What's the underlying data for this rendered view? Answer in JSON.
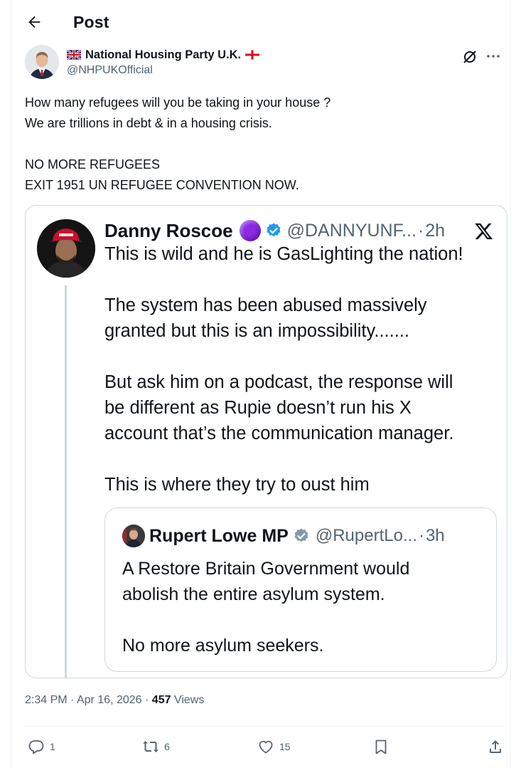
{
  "header": {
    "title": "Post"
  },
  "author": {
    "name": "National Housing Party U.K.",
    "handle": "@NHPUKOfficial"
  },
  "post": {
    "lines": [
      "How many refugees will you be taking in your house ?",
      "We are trillions in debt & in a housing crisis.",
      "",
      "NO MORE REFUGEES",
      "EXIT 1951 UN REFUGEE CONVENTION NOW."
    ]
  },
  "quoted": {
    "name": "Danny Roscoe",
    "handle": "@DANNYUNF...",
    "dot": "·",
    "time": "2h",
    "lines": [
      "This is wild and he is GasLighting the nation!",
      "",
      "The system has been abused massively",
      "granted but this is an impossibility.......",
      "",
      "But ask him on a podcast, the response will",
      "be different as Rupie doesn’t run his X",
      "account that’s the communication manager.",
      "",
      "This is where they try to oust him"
    ],
    "inner": {
      "name": "Rupert Lowe MP",
      "handle": "@RupertLo...",
      "dot": "·",
      "time": "3h",
      "lines": [
        "A Restore Britain Government would",
        "abolish the entire asylum system.",
        "",
        "No more asylum seekers."
      ]
    }
  },
  "meta": {
    "time": "2:34 PM",
    "sep": "·",
    "date": "Apr 16, 2026",
    "views_count": "457",
    "views_label": "Views"
  },
  "actions": {
    "replies": "1",
    "reposts": "6",
    "likes": "15"
  },
  "icons": {
    "back": "arrow-left-icon",
    "grok": "grok-icon",
    "more": "more-horizontal-icon",
    "x_logo": "x-logo-icon",
    "reply": "reply-icon",
    "repost": "repost-icon",
    "like": "heart-icon",
    "bookmark": "bookmark-icon",
    "share": "share-icon"
  },
  "colors": {
    "text": "#0f1419",
    "secondary": "#536471",
    "border": "#cfd9de",
    "verified": "#1d9bf0",
    "verified_grey": "#829aab",
    "purple_badge": "#8a2be2"
  }
}
